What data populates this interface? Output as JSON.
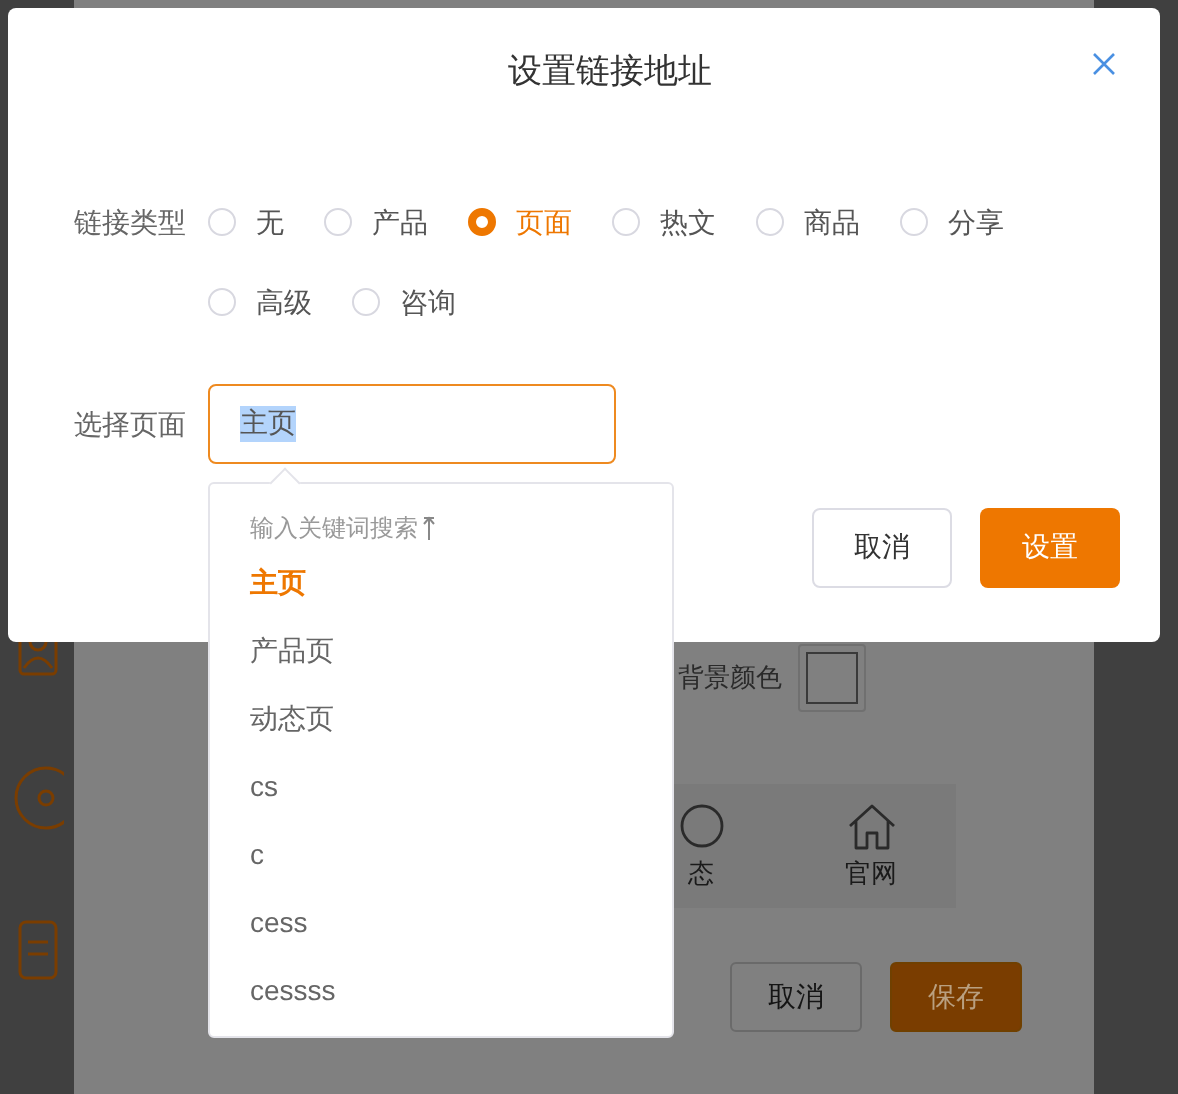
{
  "background": {
    "color_label": "背景颜色",
    "nav_items": [
      {
        "label": "态",
        "kind": "circle"
      },
      {
        "label": "官网",
        "kind": "home"
      }
    ],
    "buttons": [
      {
        "label": "取消",
        "kind": "secondary"
      },
      {
        "label": "保存",
        "kind": "primary"
      }
    ]
  },
  "dialog": {
    "title": "设置链接地址",
    "link_type": {
      "label": "链接类型",
      "options": [
        {
          "label": "无",
          "selected": false
        },
        {
          "label": "产品",
          "selected": false
        },
        {
          "label": "页面",
          "selected": true
        },
        {
          "label": "热文",
          "selected": false
        },
        {
          "label": "商品",
          "selected": false
        },
        {
          "label": "分享",
          "selected": false
        },
        {
          "label": "高级",
          "selected": false
        },
        {
          "label": "咨询",
          "selected": false
        }
      ]
    },
    "page_select": {
      "label": "选择页面",
      "value": "主页"
    },
    "buttons": [
      {
        "label": "取消",
        "kind": "secondary"
      },
      {
        "label": "设置",
        "kind": "primary"
      }
    ]
  },
  "dropdown": {
    "hint": "输入关键词搜索",
    "items": [
      {
        "label": "主页",
        "selected": true
      },
      {
        "label": "产品页",
        "selected": false
      },
      {
        "label": "动态页",
        "selected": false
      },
      {
        "label": "cs",
        "selected": false
      },
      {
        "label": "c",
        "selected": false
      },
      {
        "label": "cess",
        "selected": false
      },
      {
        "label": "cessss",
        "selected": false
      }
    ]
  }
}
